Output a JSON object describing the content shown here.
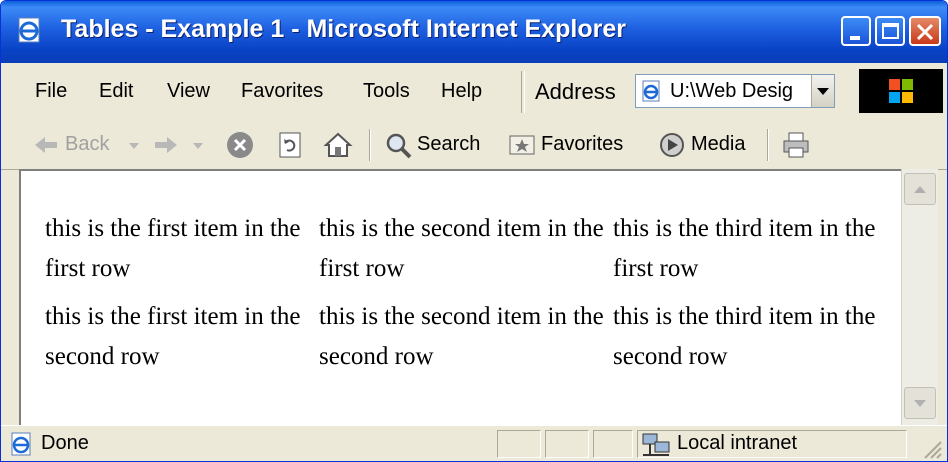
{
  "window": {
    "title": "Tables - Example 1 - Microsoft Internet Explorer",
    "controls": {
      "minimize": "minimize-icon",
      "maximize": "maximize-icon",
      "close": "close-icon"
    }
  },
  "menu": {
    "items": [
      "File",
      "Edit",
      "View",
      "Favorites",
      "Tools",
      "Help"
    ]
  },
  "address": {
    "label": "Address",
    "value": "U:\\Web Desig"
  },
  "toolbar": {
    "back": "Back",
    "search": "Search",
    "favorites": "Favorites",
    "media": "Media"
  },
  "content": {
    "rows": [
      [
        "this is the first item in the first row",
        "this is the second item in the first row",
        "this is the third item in the first row"
      ],
      [
        "this is the first item in the second row",
        "this is the second item in the second row",
        "this is the third item in the second row"
      ]
    ]
  },
  "status": {
    "text": "Done",
    "zone": "Local intranet"
  },
  "colors": {
    "titlebar": "#0a3db8",
    "chrome": "#ece9d8",
    "title_text": "#ffffff"
  }
}
